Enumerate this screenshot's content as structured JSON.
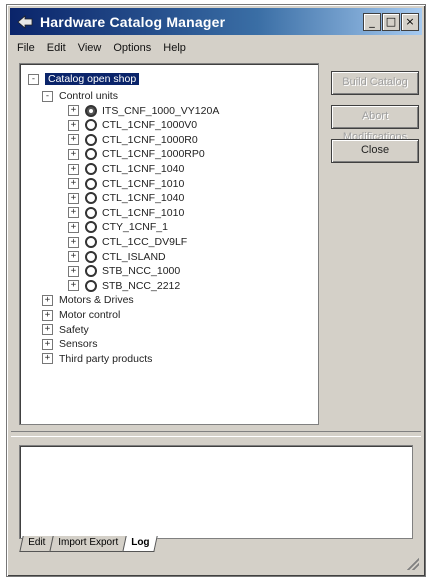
{
  "window": {
    "title": "Hardware Catalog Manager",
    "buttons": [
      "_",
      "□",
      "×"
    ]
  },
  "menubar": [
    "File",
    "Edit",
    "View",
    "Options",
    "Help"
  ],
  "tree": {
    "root": "Catalog open shop",
    "items": [
      {
        "label": "Control units",
        "level": 1,
        "expander": "-"
      },
      {
        "label": "ITS_CNF_1000_VY120A",
        "level": 2,
        "expander": "+",
        "icon": "dark"
      },
      {
        "label": "CTL_1CNF_1000V0",
        "level": 2,
        "expander": "+"
      },
      {
        "label": "CTL_1CNF_1000R0",
        "level": 2,
        "expander": "+"
      },
      {
        "label": "CTL_1CNF_1000RP0",
        "level": 2,
        "expander": "+"
      },
      {
        "label": "CTL_1CNF_1040",
        "level": 2,
        "expander": "+"
      },
      {
        "label": "CTL_1CNF_1010",
        "level": 2,
        "expander": "+"
      },
      {
        "label": "CTL_1CNF_1040",
        "level": 2,
        "expander": "+"
      },
      {
        "label": "CTL_1CNF_1010",
        "level": 2,
        "expander": "+"
      },
      {
        "label": "CTY_1CNF_1",
        "level": 2,
        "expander": "+"
      },
      {
        "label": "CTL_1CC_DV9LF",
        "level": 2,
        "expander": "+"
      },
      {
        "label": "CTL_ISLAND",
        "level": 2,
        "expander": "+"
      },
      {
        "label": "STB_NCC_1000",
        "level": 2,
        "expander": "+"
      },
      {
        "label": "STB_NCC_2212",
        "level": 2,
        "expander": "+"
      },
      {
        "label": "Motors & Drives",
        "level": 1,
        "expander": "+"
      },
      {
        "label": "Motor control",
        "level": 1,
        "expander": "+"
      },
      {
        "label": "Safety",
        "level": 1,
        "expander": "+"
      },
      {
        "label": "Sensors",
        "level": 1,
        "expander": "+"
      },
      {
        "label": "Third party products",
        "level": 1,
        "expander": "+"
      }
    ]
  },
  "actions": {
    "build": "Build Catalog",
    "abort": "Abort Modifications",
    "close": "Close"
  },
  "tabs": [
    "Edit",
    "Import Export",
    "Log"
  ],
  "active_tab": "Log"
}
